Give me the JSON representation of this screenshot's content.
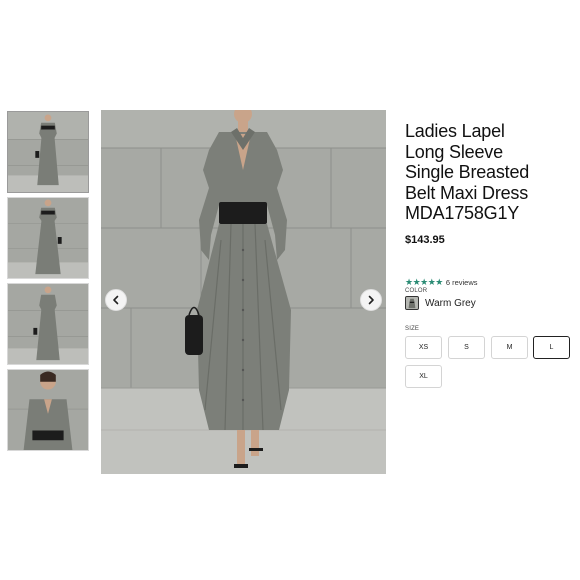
{
  "product": {
    "title_lines": [
      "Ladies Lapel",
      "Long Sleeve",
      "Single Breasted",
      "Belt Maxi Dress",
      "MDA1758G1Y"
    ],
    "price": "$143.95",
    "rating": {
      "stars": "★★★★★",
      "stars_value": 5,
      "review_count": "6 reviews"
    },
    "color": {
      "label": "COLOR",
      "selected": "Warm Grey"
    },
    "size": {
      "label": "SIZE",
      "options": [
        "XS",
        "S",
        "M",
        "L",
        "XL"
      ],
      "selected": "L"
    }
  },
  "gallery": {
    "thumbnails": [
      "thumbnail-1",
      "thumbnail-2",
      "thumbnail-3",
      "thumbnail-4"
    ],
    "active_index": 0
  },
  "icons": {
    "prev": "chevron-left-icon",
    "next": "chevron-right-icon",
    "star": "star-icon"
  },
  "colors": {
    "star": "#2a8b74",
    "dress": "#7c7f79",
    "wall": "#a7a9a4",
    "belt": "#1c1c1c"
  }
}
